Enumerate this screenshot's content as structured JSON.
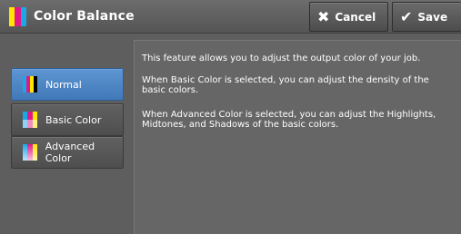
{
  "window": {
    "title": "Color Balance"
  },
  "toolbar": {
    "cancel_label": "Cancel",
    "save_label": "Save"
  },
  "options": [
    {
      "label": "Normal",
      "selected": true
    },
    {
      "label": "Basic Color",
      "selected": false
    },
    {
      "label": "Advanced Color",
      "selected": false
    }
  ],
  "description": {
    "p1": "This feature allows you to adjust the output color of your job.",
    "p2": "When Basic Color is selected, you can adjust the density of the basic colors.",
    "p3": "When Advanced Color is selected, you can adjust the Highlights, Midtones, and Shadows of the basic colors."
  },
  "colors": {
    "selected": "#4f86c6",
    "cyan": "#1aa8e6",
    "magenta": "#e0198a",
    "yellow": "#ffe600",
    "black": "#000000"
  },
  "icons": {
    "cancel": "x-icon",
    "save": "checkmark-icon",
    "title": "color-balance-icon"
  }
}
